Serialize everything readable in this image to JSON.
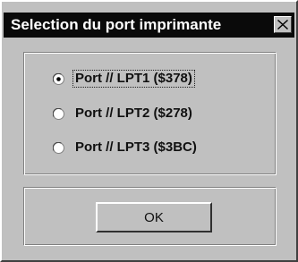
{
  "dialog": {
    "title": "Selection du port imprimante",
    "close_icon": "close-icon"
  },
  "ports": {
    "options": [
      {
        "label": "Port // LPT1 ($378)",
        "selected": true
      },
      {
        "label": "Port // LPT2 ($278)",
        "selected": false
      },
      {
        "label": "Port // LPT3 ($3BC)",
        "selected": false
      }
    ]
  },
  "buttons": {
    "ok_label": "OK"
  },
  "colors": {
    "title_bar": "#0a0a0a",
    "title_text": "#ffffff",
    "face": "#c0c0c0"
  }
}
